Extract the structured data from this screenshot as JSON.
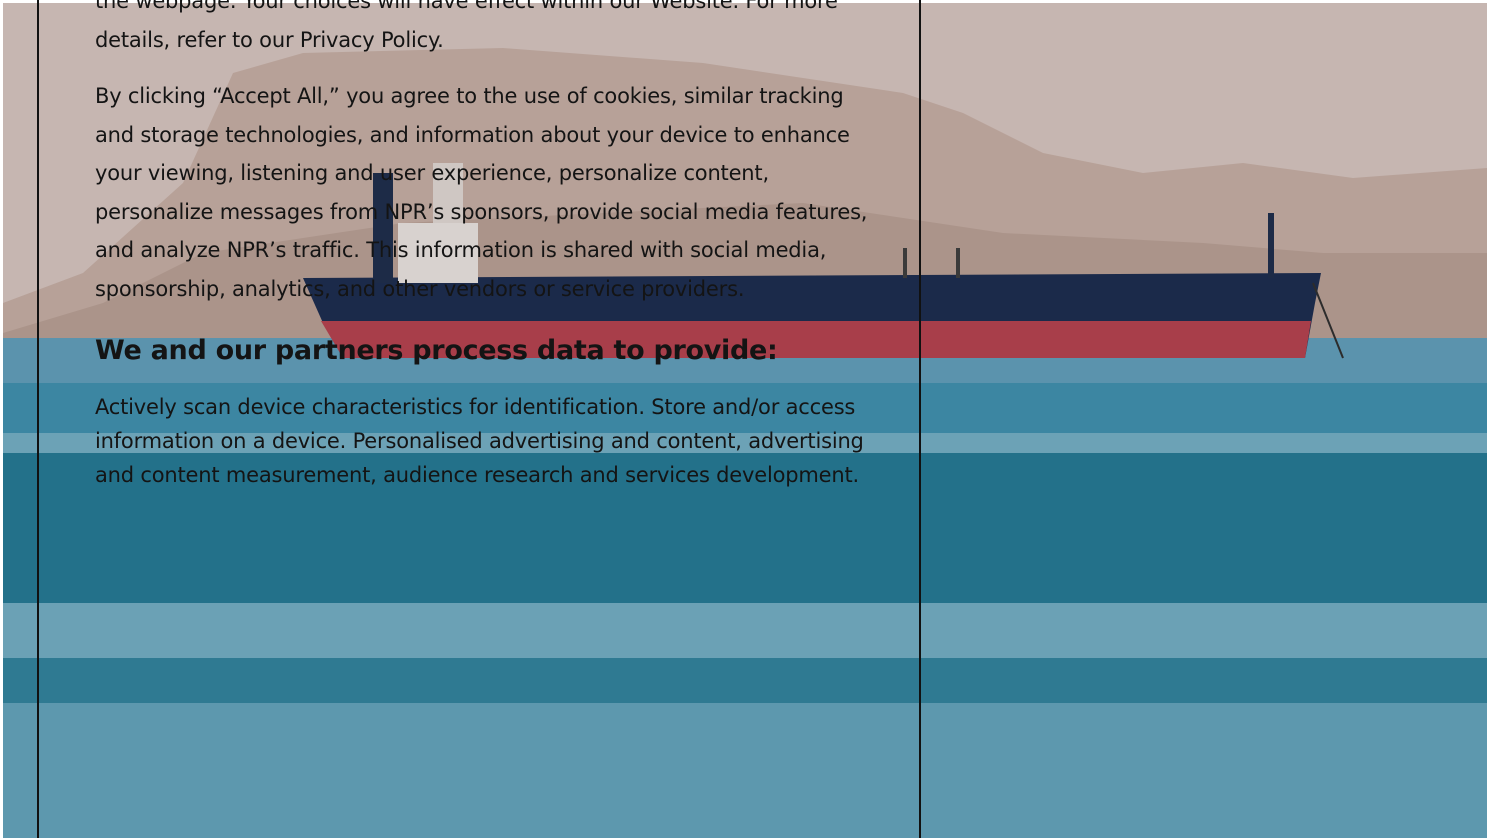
{
  "consent": {
    "intro_text": "the webpage. Your choices will have effect within our Website. For more details, refer to our Privacy Policy.",
    "accept_text": "By clicking “Accept All,” you agree to the use of cookies, similar tracking and storage technologies, and information about your device to enhance your viewing, listening and user experience, personalize content, personalize messages from NPR’s sponsors, provide social media features, and analyze NPR’s traffic. This information is shared with social media, sponsorship, analytics, and other vendors or service providers.",
    "purposes_heading": "We and our partners process data to provide:",
    "purposes_text": "Actively scan device characteristics for identification. Store and/or access information on a device. Personalised advertising and content, advertising and content measurement, audience research and services development."
  },
  "colors": {
    "text": "#141414",
    "border": "#111111"
  }
}
